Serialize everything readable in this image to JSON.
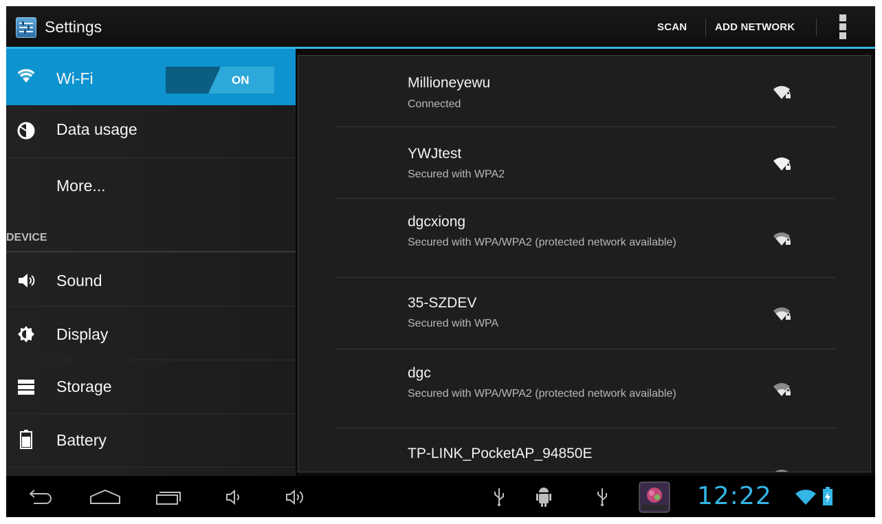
{
  "action_bar": {
    "title": "Settings",
    "scan_label": "SCAN",
    "add_network_label": "ADD NETWORK",
    "accent_color": "#33b5e5"
  },
  "sidebar": {
    "wifi": {
      "label": "Wi-Fi",
      "toggle_state": "ON",
      "icon": "wifi-icon"
    },
    "items": [
      {
        "label": "Data usage",
        "icon": "data-usage-icon"
      },
      {
        "label": "More..."
      }
    ],
    "section_device": "DEVICE",
    "device_items": [
      {
        "label": "Sound",
        "icon": "sound-icon"
      },
      {
        "label": "Display",
        "icon": "display-icon"
      },
      {
        "label": "Storage",
        "icon": "storage-icon"
      },
      {
        "label": "Battery",
        "icon": "battery-icon"
      }
    ],
    "selected_color": "#0d93cf"
  },
  "networks": [
    {
      "name": "Millioneyewu",
      "status": "Connected"
    },
    {
      "name": "YWJtest",
      "status": "Secured with WPA2"
    },
    {
      "name": "dgcxiong",
      "status": "Secured with WPA/WPA2 (protected network available)"
    },
    {
      "name": "35-SZDEV",
      "status": "Secured with WPA"
    },
    {
      "name": "dgc",
      "status": "Secured with WPA/WPA2 (protected network available)"
    },
    {
      "name": "TP-LINK_PocketAP_94850E",
      "status": ""
    }
  ],
  "system_bar": {
    "clock": "12:22",
    "clock_color": "#33b5e5",
    "icons": [
      "back-icon",
      "home-icon",
      "recent-apps-icon",
      "volume-down-icon",
      "volume-up-icon",
      "usb-icon",
      "android-debug-icon",
      "usb-icon",
      "app-notification-icon",
      "wifi-status-icon",
      "battery-charging-icon"
    ]
  }
}
